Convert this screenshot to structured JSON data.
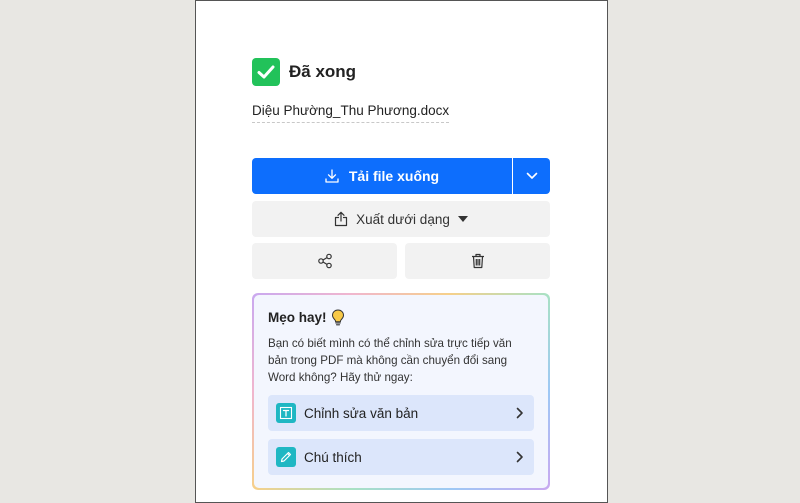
{
  "status": {
    "title": "Đã xong",
    "icon": "check-icon",
    "color": "#22c25a"
  },
  "file": {
    "name": "Diệu Phường_Thu Phương.docx"
  },
  "actions": {
    "download_label": "Tải file xuống",
    "download_icon": "download-icon",
    "dropdown_icon": "chevron-down-icon",
    "export_label": "Xuất dưới dạng",
    "export_icon": "share-up-icon",
    "share_icon": "share-icon",
    "delete_icon": "trash-icon",
    "accent": "#0d6efd"
  },
  "tip": {
    "title": "Mẹo hay!",
    "title_icon": "lightbulb-icon",
    "text": "Bạn có biết mình có thể chỉnh sửa trực tiếp văn bản trong PDF mà không cần chuyển đổi sang Word không? Hãy thử ngay:",
    "items": [
      {
        "label": "Chỉnh sửa văn bản",
        "icon": "edit-text-icon"
      },
      {
        "label": "Chú thích",
        "icon": "pencil-icon"
      }
    ]
  }
}
